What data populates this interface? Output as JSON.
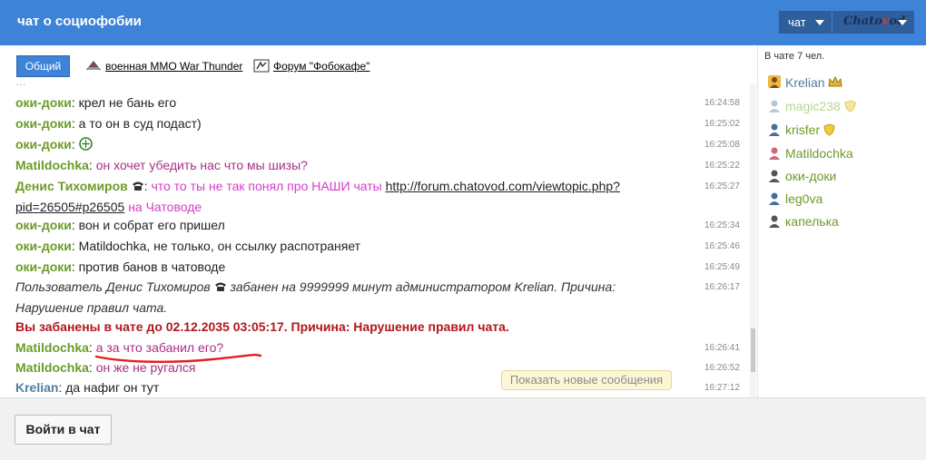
{
  "header": {
    "title": "чат о социофобии",
    "chat_menu_label": "чат",
    "brand_left": "Chato",
    "brand_mid": "v",
    "brand_right": "od"
  },
  "tabs": {
    "general": "Общий",
    "rooms": [
      {
        "label": "военная MMO War Thunder",
        "icon": "war-thunder-icon"
      },
      {
        "label": "Форум \"Фобокафе\"",
        "icon": "forum-icon"
      }
    ]
  },
  "messages": [
    {
      "nick": "оки-доки",
      "text": "крел не бань его",
      "time": "16:24:58"
    },
    {
      "nick": "оки-доки",
      "text": "а то он в суд подаст)",
      "time": "16:25:02"
    },
    {
      "nick": "оки-доки",
      "text": "",
      "time": "16:25:08",
      "icon": "smiley-icon"
    },
    {
      "nick": "Matildochka",
      "text": "он хочет убедить нас что мы шизы?",
      "time": "16:25:22"
    },
    {
      "nick": "Денис Тихомиров",
      "text": "что то ты не так понял про НАШИ чаты",
      "link_line1": "http://forum.chatovod.com/viewtopic.php?",
      "link_line2": "pid=26505#p26505",
      "tail": "на Чатоводе",
      "time": "16:25:27"
    },
    {
      "nick": "оки-доки",
      "text": "вон и собрат его пришел",
      "time": "16:25:34"
    },
    {
      "nick": "оки-доки",
      "text": "Matildochka, не только, он ссылку распотраняет",
      "time": "16:25:46"
    },
    {
      "nick": "оки-доки",
      "text": "против банов в чатоводе",
      "time": "16:25:49"
    },
    {
      "system_line1_a": "Пользователь Денис Тихомиров",
      "system_line1_b": "забанен на 9999999 минут администратором Krelian. Причина:",
      "system_line2": "Нарушение правил чата.",
      "time": "16:26:17"
    },
    {
      "ban": "Вы забанены в чате до 02.12.2035 03:05:17. Причина: Нарушение правил чата."
    },
    {
      "nick": "Matildochka",
      "text": "а за что забанил его?",
      "time": "16:26:41"
    },
    {
      "nick": "Matildochka",
      "text": "он же не ругался",
      "time": "16:26:52"
    },
    {
      "nick": "Krelian",
      "text": "да нафиг он тут",
      "time": "16:27:12"
    }
  ],
  "new_messages_button": "Показать новые сообщения",
  "sidebar": {
    "online": "В чате 7 чел.",
    "users": [
      "Krelian",
      "magic238",
      "krisfer",
      "Matildochka",
      "оки-доки",
      "leg0va",
      "капелька"
    ]
  },
  "footer": {
    "login_button": "Войти в чат"
  },
  "colors": {
    "header": "#3d83d8",
    "nick_green": "#6d9b2a",
    "nick_blue": "#4f7e9e",
    "ban_red": "#b2171b",
    "pink_text": "#a72f86"
  }
}
